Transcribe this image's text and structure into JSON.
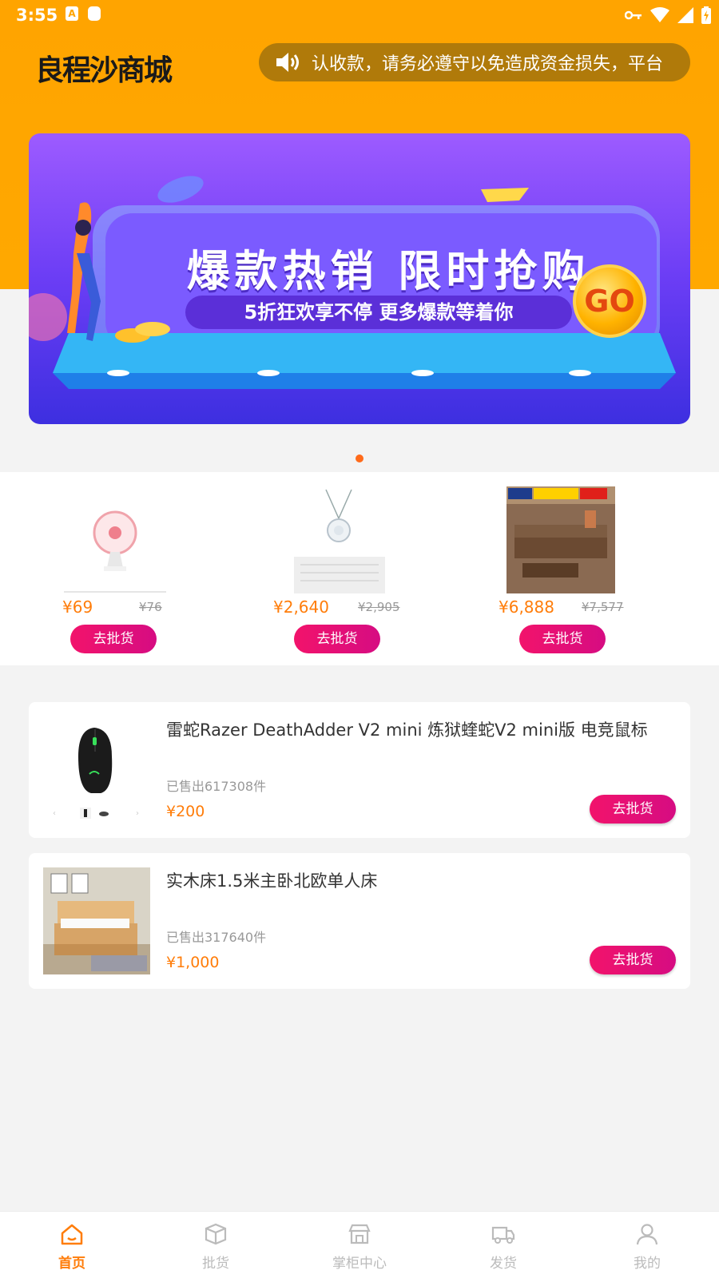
{
  "status_bar": {
    "time": "3:55",
    "icon_a": "A"
  },
  "app": {
    "logo_text": "良程沙商城"
  },
  "notice": {
    "text": "认收款，请务必遵守以免造成资金损失，平台"
  },
  "banner": {
    "title": "爆款热销  限时抢购",
    "subtitle": "5折狂欢享不停  更多爆款等着你",
    "go_label": "GO"
  },
  "featured_products": [
    {
      "price": "¥69",
      "old_price": "¥76",
      "button": "去批货"
    },
    {
      "price": "¥2,640",
      "old_price": "¥2,905",
      "button": "去批货"
    },
    {
      "price": "¥6,888",
      "old_price": "¥7,577",
      "button": "去批货"
    }
  ],
  "list_products": [
    {
      "title": "雷蛇Razer DeathAdder V2 mini 炼狱蝰蛇V2 mini版 电竞鼠标",
      "sold": "已售出617308件",
      "price": "¥200",
      "button": "去批货"
    },
    {
      "title": "实木床1.5米主卧北欧单人床",
      "sold": "已售出317640件",
      "price": "¥1,000",
      "button": "去批货"
    }
  ],
  "tabbar": {
    "items": [
      {
        "label": "首页",
        "icon": "home-icon",
        "active": true
      },
      {
        "label": "批货",
        "icon": "box-icon",
        "active": false
      },
      {
        "label": "掌柜中心",
        "icon": "store-icon",
        "active": false
      },
      {
        "label": "发货",
        "icon": "truck-icon",
        "active": false
      },
      {
        "label": "我的",
        "icon": "user-icon",
        "active": false
      }
    ]
  },
  "colors": {
    "brand_orange": "#ffa400",
    "accent_pink": "#f2136b",
    "price_orange": "#ff7d0a"
  }
}
